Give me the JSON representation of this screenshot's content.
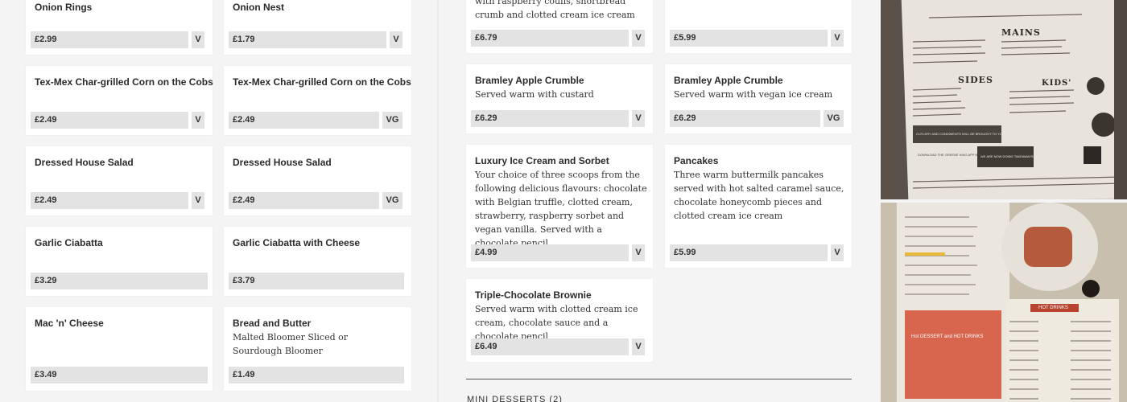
{
  "left_col_a": [
    {
      "title": "Onion Rings",
      "price": "£2.99",
      "badge": "V"
    },
    {
      "title": "Tex-Mex Char-grilled Corn on the Cobs",
      "price": "£2.49",
      "badge": "V"
    },
    {
      "title": "Dressed House Salad",
      "price": "£2.49",
      "badge": "V"
    },
    {
      "title": "Garlic Ciabatta",
      "price": "£3.29",
      "badge": ""
    },
    {
      "title": "Mac 'n' Cheese",
      "price": "£3.49",
      "badge": ""
    }
  ],
  "left_col_b": [
    {
      "title": "Onion Nest",
      "price": "£1.79",
      "badge": "V"
    },
    {
      "title": "Tex-Mex Char-grilled Corn on the Cobs",
      "price": "£2.49",
      "badge": "VG"
    },
    {
      "title": "Dressed House Salad",
      "price": "£2.49",
      "badge": "VG"
    },
    {
      "title": "Garlic Ciabatta with Cheese",
      "price": "£3.79",
      "badge": ""
    },
    {
      "title": "Bread and Butter",
      "desc": "Malted Bloomer Sliced or Sourdough Bloomer",
      "price": "£1.49",
      "badge": ""
    }
  ],
  "desserts_a": [
    {
      "desc": "with raspberry coulis, shortbread crumb and clotted cream ice cream",
      "price": "£6.79",
      "badge": "V"
    },
    {
      "title": "Bramley Apple Crumble",
      "desc": "Served warm with custard",
      "price": "£6.29",
      "badge": "V"
    },
    {
      "title": "Luxury Ice Cream and Sorbet",
      "desc": "Your choice of three scoops from the following delicious flavours: chocolate with Belgian truffle, clotted cream, strawberry, raspberry sorbet and vegan vanilla. Served with a chocolate pencil",
      "price": "£4.99",
      "badge": "V"
    },
    {
      "title": "Triple-Chocolate Brownie",
      "desc": "Served warm with clotted cream ice cream, chocolate sauce and a chocolate pencil",
      "price": "£6.49",
      "badge": "V"
    }
  ],
  "desserts_b": [
    {
      "price": "£5.99",
      "badge": "V"
    },
    {
      "title": "Bramley Apple Crumble",
      "desc": "Served warm with vegan ice cream",
      "price": "£6.29",
      "badge": "VG"
    },
    {
      "title": "Pancakes",
      "desc": "Three warm buttermilk pancakes served with hot salted caramel sauce, chocolate honeycomb pieces and clotted cream ice cream",
      "price": "£5.99",
      "badge": "V"
    }
  ],
  "section_label": "MINI DESSERTS (2)",
  "photo1": {
    "mains_heading": "MAINS",
    "sides_heading": "SIDES",
    "kids_heading": "KIDS'",
    "banner": "WE ARE NOW DOING TAKEAWAYS",
    "app_text": "DOWNLOAD THE GREENE KING APP NOW!",
    "cutlery": "CUTLERY AND CONDIMENTS WILL BE BROUGHT TO YOUR TABLE"
  },
  "photo2": {
    "card_title": "Hot DESSERT and HOT DRINKS",
    "hot_drinks_heading": "HOT DRINKS"
  },
  "colors": {
    "price_bg": "#e3e3e3",
    "card_bg": "#ffffff",
    "page_bg": "#f4f4f4"
  }
}
